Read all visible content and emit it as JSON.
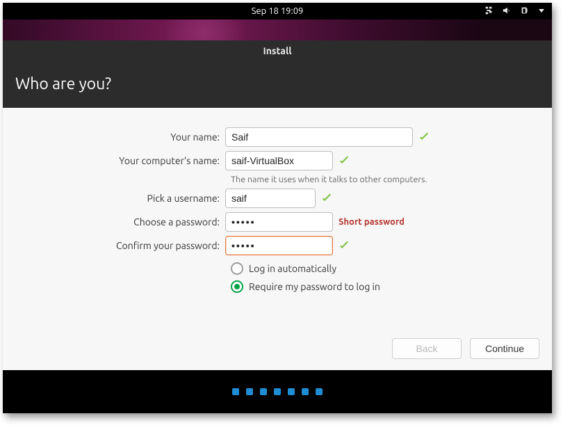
{
  "topbar": {
    "datetime": "Sep 18  19:09"
  },
  "window": {
    "title": "Install"
  },
  "header": {
    "title": "Who are you?"
  },
  "form": {
    "name_label": "Your name:",
    "name_value": "Saif",
    "computer_label": "Your computer's name:",
    "computer_value": "saif-VirtualBox",
    "computer_hint": "The name it uses when it talks to other computers.",
    "username_label": "Pick a username:",
    "username_value": "saif",
    "password_label": "Choose a password:",
    "password_value": "•••••",
    "password_strength": "Short password",
    "confirm_label": "Confirm your password:",
    "confirm_value": "•••••",
    "login_auto": "Log in automatically",
    "login_pw": "Require my password to log in",
    "login_selected": "pw"
  },
  "buttons": {
    "back": "Back",
    "continue": "Continue"
  },
  "progress": {
    "dots": 7
  }
}
